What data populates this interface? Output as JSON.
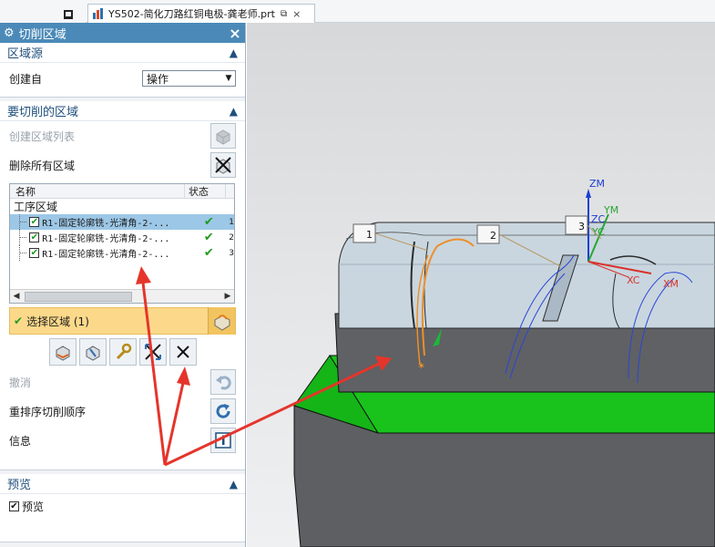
{
  "window": {
    "file_tab_title": "YS502-简化刀路红铜电极-龚老师.prt",
    "file_tab_pin": "⧉",
    "file_tab_close": "×"
  },
  "dialog": {
    "title": "切削区域",
    "close": "×",
    "sections": {
      "region_source": {
        "header": "区域源",
        "create_from_label": "创建自",
        "create_from_value": "操作"
      },
      "regions_to_cut": {
        "header": "要切削的区域",
        "create_region_list": "创建区域列表",
        "delete_all_regions": "删除所有区域",
        "list": {
          "columns": [
            "名称",
            "状态"
          ],
          "root": "工序区域",
          "items": [
            {
              "name": "R1-固定轮廓铣-光清角-2-...",
              "status": "✔",
              "extra": "1",
              "selected": true
            },
            {
              "name": "R1-固定轮廓铣-光清角-2-...",
              "status": "✔",
              "extra": "2",
              "selected": false
            },
            {
              "name": "R1-固定轮廓铣-光清角-2-...",
              "status": "✔",
              "extra": "3",
              "selected": false
            }
          ]
        },
        "select_region": "选择区域 (1)",
        "undo": "撤消",
        "reorder": "重排序切削顺序",
        "info": "信息"
      },
      "preview": {
        "header": "预览",
        "checkbox_label": "预览"
      }
    }
  },
  "viewport": {
    "region_tags": [
      "1",
      "2",
      "3"
    ],
    "csys_labels": [
      "ZM",
      "ZC",
      "YM",
      "YC",
      "XC",
      "XM"
    ]
  },
  "colors": {
    "dialog_title_bg": "#4b8ab8",
    "section_header_text": "#1f4f7c",
    "select_region_bg": "#fcd98a",
    "list_selected_bg": "#9cc7e6",
    "status_check": "#1e9c1e",
    "part_body": "#c9d6df",
    "fixture_dark": "#5d5f62",
    "fixture_green": "#19c31c",
    "arrow_red": "#e5352b"
  }
}
